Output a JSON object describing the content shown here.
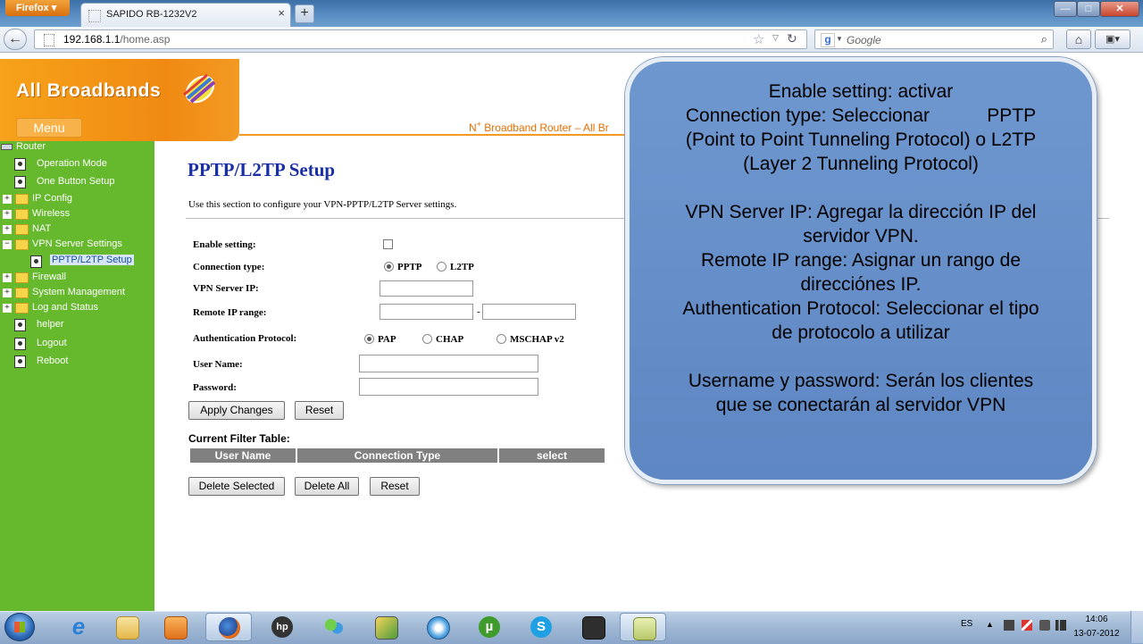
{
  "browser": {
    "app_button": "Firefox",
    "tab_title": "SAPIDO RB-1232V2",
    "url_host": "192.168.1.1",
    "url_path": "/home.asp",
    "search_placeholder": "Google"
  },
  "router": {
    "logo": "All Broadbands",
    "menu_label": "Menu",
    "tagline_prefix": "N",
    "tagline_sup": "+",
    "tagline_rest": " Broadband Router – All Br",
    "sidebar": {
      "root": "Router",
      "items": [
        "Operation Mode",
        "One Button Setup",
        "IP Config",
        "Wireless",
        "NAT",
        "VPN Server Settings",
        "PPTP/L2TP Setup",
        "Firewall",
        "System Management",
        "Log and Status",
        "helper",
        "Logout",
        "Reboot"
      ]
    },
    "page_title": "PPTP/L2TP Setup",
    "description": "Use this section to configure your VPN-PPTP/L2TP Server settings.",
    "form": {
      "enable_label": "Enable setting:",
      "connection_type_label": "Connection type:",
      "connection_options": [
        "PPTP",
        "L2TP"
      ],
      "vpn_server_ip_label": "VPN Server IP:",
      "remote_ip_range_label": "Remote IP range:",
      "range_separator": "-",
      "auth_label": "Authentication Protocol:",
      "auth_options": [
        "PAP",
        "CHAP",
        "MSCHAP v2"
      ],
      "username_label": "User Name:",
      "password_label": "Password:",
      "apply_button": "Apply Changes",
      "reset_button": "Reset"
    },
    "filter_table": {
      "title": "Current Filter Table:",
      "columns": [
        "User Name",
        "Connection Type",
        "select"
      ],
      "delete_selected": "Delete Selected",
      "delete_all": "Delete All",
      "reset": "Reset"
    }
  },
  "callout": {
    "lines": [
      "Enable setting: activar",
      "Connection type: Seleccionar           PPTP",
      "(Point to Point Tunneling Protocol) o L2TP",
      "(Layer 2 Tunneling Protocol)",
      "",
      "VPN Server IP: Agregar la dirección IP del",
      "servidor VPN.",
      "Remote IP range: Asignar un rango de",
      "direcciónes IP.",
      "Authentication Protocol: Seleccionar el tipo",
      "de protocolo a utilizar",
      "",
      "Username y password: Serán los clientes",
      "que se conectarán al servidor VPN"
    ]
  },
  "taskbar": {
    "language": "ES",
    "time": "14:06",
    "date": "13-07-2012"
  }
}
